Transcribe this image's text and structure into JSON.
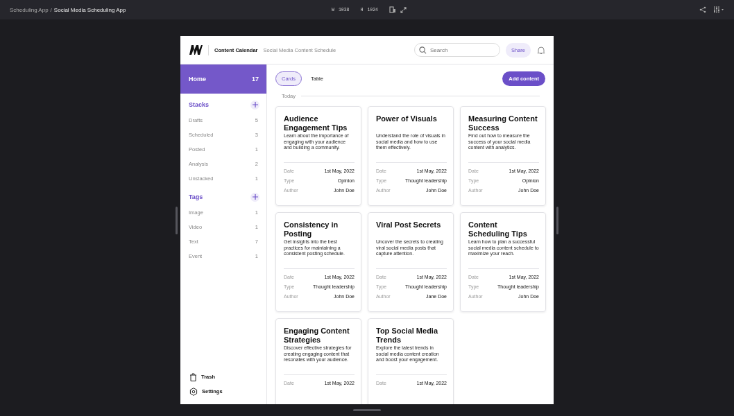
{
  "topbar": {
    "breadcrumb_parent": "Scheduling App",
    "breadcrumb_separator": "/",
    "breadcrumb_current": "Social Media Scheduling App",
    "width_label": "W",
    "width_value": "1038",
    "height_label": "H",
    "height_value": "1024"
  },
  "header": {
    "title": "Content Calendar",
    "subtitle": "Social Media Content Schedule",
    "search": {
      "placeholder": "Search"
    },
    "share": "Share"
  },
  "sidebar": {
    "home": {
      "label": "Home",
      "count": "17",
      "selected": true
    },
    "sections": [
      {
        "title": "Stacks",
        "items": [
          {
            "label": "Drafts",
            "count": "5"
          },
          {
            "label": "Scheduled",
            "count": "3"
          },
          {
            "label": "Posted",
            "count": "1"
          },
          {
            "label": "Analysis",
            "count": "2"
          },
          {
            "label": "Unstacked",
            "count": "1"
          }
        ]
      },
      {
        "title": "Tags",
        "items": [
          {
            "label": "Image",
            "count": "1"
          },
          {
            "label": "Video",
            "count": "1"
          },
          {
            "label": "Text",
            "count": "7"
          },
          {
            "label": "Event",
            "count": "1"
          }
        ]
      }
    ],
    "footer": [
      {
        "kind": "trash",
        "label": "Trash"
      },
      {
        "kind": "settings",
        "label": "Settings"
      }
    ]
  },
  "views": [
    {
      "label": "Cards",
      "selected": true
    },
    {
      "label": "Table",
      "selected": false
    }
  ],
  "add_button": "Add content",
  "group_label": "Today",
  "cards": [
    {
      "title": "Audience Engagement Tips",
      "description": "Learn about the importance of engaging with your audience and building a community.",
      "meta": [
        {
          "label": "Date",
          "value": "1st May, 2022"
        },
        {
          "label": "Type",
          "value": "Opinion"
        },
        {
          "label": "Author",
          "value": "John Doe"
        }
      ]
    },
    {
      "title": "Power of Visuals",
      "description": "Understand the role of visuals in social media and how to use them effectively.",
      "meta": [
        {
          "label": "Date",
          "value": "1st May, 2022"
        },
        {
          "label": "Type",
          "value": "Thought leadership"
        },
        {
          "label": "Author",
          "value": "John Doe"
        }
      ]
    },
    {
      "title": "Measuring Content Success",
      "description": "Find out how to measure the success of your social media content with analytics.",
      "meta": [
        {
          "label": "Date",
          "value": "1st May, 2022"
        },
        {
          "label": "Type",
          "value": "Opinion"
        },
        {
          "label": "Author",
          "value": "John Doe"
        }
      ]
    },
    {
      "title": "Consistency in Posting",
      "description": "Get insights into the best practices for maintaining a consistent posting schedule.",
      "meta": [
        {
          "label": "Date",
          "value": "1st May, 2022"
        },
        {
          "label": "Type",
          "value": "Thought leadership"
        },
        {
          "label": "Author",
          "value": "John Doe"
        }
      ]
    },
    {
      "title": "Viral Post Secrets",
      "description": "Uncover the secrets to creating viral social media posts that capture attention.",
      "meta": [
        {
          "label": "Date",
          "value": "1st May, 2022"
        },
        {
          "label": "Type",
          "value": "Thought leadership"
        },
        {
          "label": "Author",
          "value": "Jane Doe"
        }
      ]
    },
    {
      "title": "Content Scheduling Tips",
      "description": "Learn how to plan a successful social media content schedule to maximize your reach.",
      "meta": [
        {
          "label": "Date",
          "value": "1st May, 2022"
        },
        {
          "label": "Type",
          "value": "Thought leadership"
        },
        {
          "label": "Author",
          "value": "John Doe"
        }
      ]
    },
    {
      "title": "Engaging Content Strategies",
      "description": "Discover effective strategies for creating engaging content that resonates with your audience.",
      "meta": [
        {
          "label": "Date",
          "value": "1st May, 2022"
        }
      ]
    },
    {
      "title": "Top Social Media Trends",
      "description": "Explore the latest trends in social media content creation and boost your engagement.",
      "meta": [
        {
          "label": "Date",
          "value": "1st May, 2022"
        }
      ]
    }
  ]
}
